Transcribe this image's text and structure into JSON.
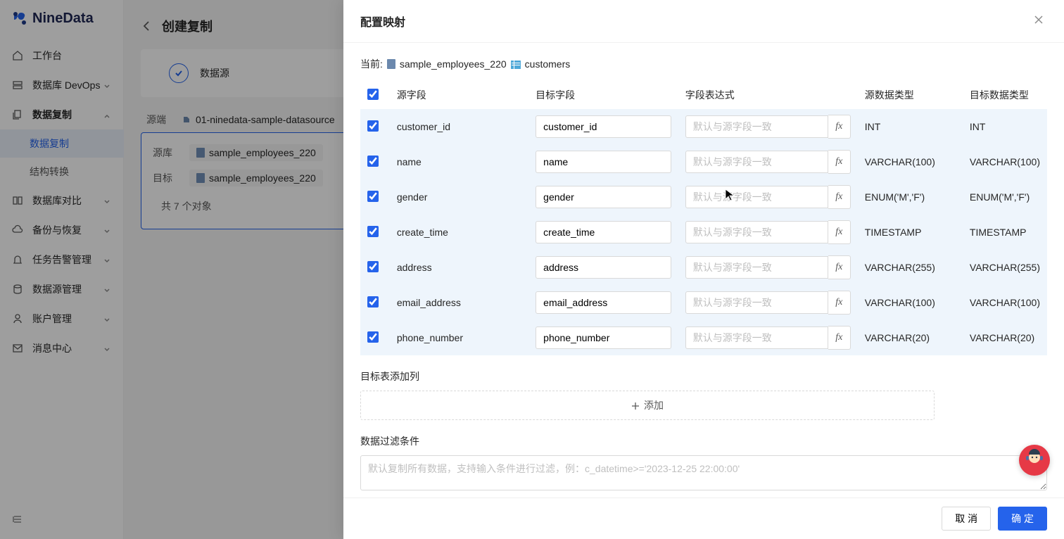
{
  "brand": "NineData",
  "nav": {
    "workspace": "工作台",
    "database_devops": "数据库 DevOps",
    "data_copy": "数据复制",
    "sub": {
      "data_copy": "数据复制",
      "struct_convert": "结构转换"
    },
    "db_compare": "数据库对比",
    "backup_restore": "备份与恢复",
    "task_alarm": "任务告警管理",
    "datasource_mgmt": "数据源管理",
    "account_mgmt": "账户管理",
    "message_center": "消息中心"
  },
  "page": {
    "title": "创建复制",
    "step_label": "数据源",
    "source_label": "源端",
    "source_value": "01-ninedata-sample-datasource",
    "card": {
      "src_db_label": "源库",
      "src_db_value": "sample_employees_220",
      "tgt_label": "目标",
      "tgt_value": "sample_employees_220",
      "objects_count": "共 7 个对象"
    }
  },
  "modal": {
    "title": "配置映射",
    "breadcrumb_prefix": "当前:",
    "breadcrumb_db": "sample_employees_220",
    "breadcrumb_table": "customers",
    "columns": {
      "source_field": "源字段",
      "target_field": "目标字段",
      "field_expr": "字段表达式",
      "source_type": "源数据类型",
      "target_type": "目标数据类型"
    },
    "expr_placeholder": "默认与源字段一致",
    "rows": [
      {
        "source": "customer_id",
        "target": "customer_id",
        "src_type": "INT",
        "tgt_type": "INT"
      },
      {
        "source": "name",
        "target": "name",
        "src_type": "VARCHAR(100)",
        "tgt_type": "VARCHAR(100)"
      },
      {
        "source": "gender",
        "target": "gender",
        "src_type": "ENUM('M','F')",
        "tgt_type": "ENUM('M','F')"
      },
      {
        "source": "create_time",
        "target": "create_time",
        "src_type": "TIMESTAMP",
        "tgt_type": "TIMESTAMP"
      },
      {
        "source": "address",
        "target": "address",
        "src_type": "VARCHAR(255)",
        "tgt_type": "VARCHAR(255)"
      },
      {
        "source": "email_address",
        "target": "email_address",
        "src_type": "VARCHAR(100)",
        "tgt_type": "VARCHAR(100)"
      },
      {
        "source": "phone_number",
        "target": "phone_number",
        "src_type": "VARCHAR(20)",
        "tgt_type": "VARCHAR(20)"
      }
    ],
    "add_column_section": "目标表添加列",
    "add_button": "添加",
    "filter_section": "数据过滤条件",
    "filter_placeholder": "默认复制所有数据，支持输入条件进行过滤，例：c_datetime>='2023-12-25 22:00:00'",
    "cancel": "取 消",
    "confirm": "确 定"
  }
}
